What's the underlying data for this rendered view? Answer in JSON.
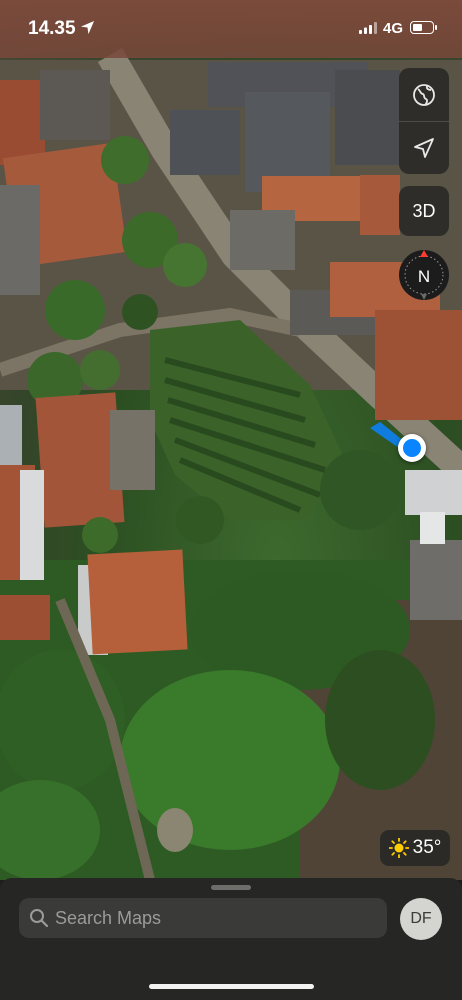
{
  "status_bar": {
    "time": "14.35",
    "network": "4G"
  },
  "controls": {
    "globe_icon": "globe-icon",
    "location_icon": "location-arrow-icon",
    "view_3d_label": "3D",
    "compass_label": "N"
  },
  "weather": {
    "icon": "sun-icon",
    "temperature": "35°"
  },
  "search": {
    "placeholder": "Search Maps"
  },
  "profile": {
    "initials": "DF"
  },
  "colors": {
    "accent": "#0a84ff",
    "compass_needle": "#ff3b30"
  }
}
